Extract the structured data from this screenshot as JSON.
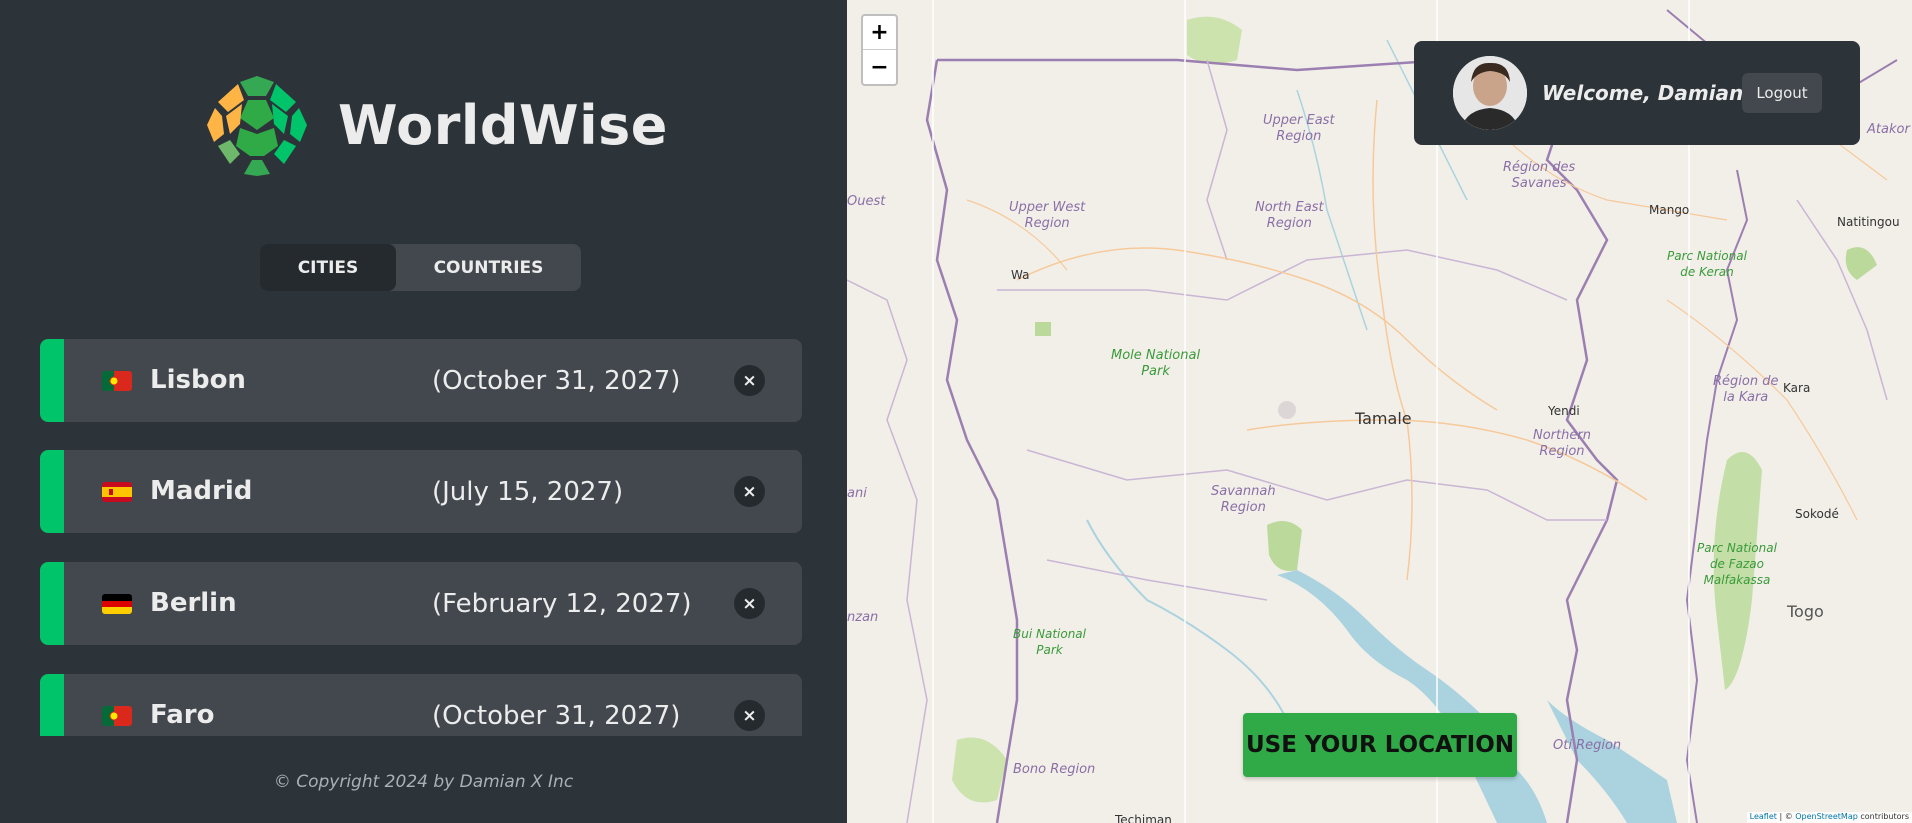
{
  "app": {
    "name": "WorldWise"
  },
  "tabs": [
    {
      "label": "CITIES",
      "active": true
    },
    {
      "label": "COUNTRIES",
      "active": false
    }
  ],
  "cities": [
    {
      "flag": "pt",
      "name": "Lisbon",
      "date": "(October 31, 2027)",
      "delete_label": "×"
    },
    {
      "flag": "es",
      "name": "Madrid",
      "date": "(July 15, 2027)",
      "delete_label": "×"
    },
    {
      "flag": "de",
      "name": "Berlin",
      "date": "(February 12, 2027)",
      "delete_label": "×"
    },
    {
      "flag": "pt",
      "name": "Faro",
      "date": "(October 31, 2027)",
      "delete_label": "×"
    }
  ],
  "footer": {
    "copyright": "© Copyright 2024 by Damian X Inc"
  },
  "map": {
    "zoom_in": "+",
    "zoom_out": "−",
    "labels": {
      "upper_east": "Upper East\nRegion",
      "upper_west": "Upper West\nRegion",
      "north_east": "North East\nRegion",
      "savanes": "Région des\nSavanes",
      "keran": "Parc National\nde Keran",
      "mole": "Mole National\nPark",
      "tamale": "Tamale",
      "yendi": "Yendi",
      "northern": "Northern\nRegion",
      "kara_region": "Région de\nla Kara",
      "kara": "Kara",
      "savannah": "Savannah\nRegion",
      "bui": "Bui National\nPark",
      "fazao": "Parc National\nde Fazao\nMalfakassa",
      "sokode": "Sokodé",
      "togo": "Togo",
      "oti": "Oti Region",
      "bono": "Bono Region",
      "wa": "Wa",
      "mango": "Mango",
      "natitingou": "Natitingou",
      "atakora": "Atakor",
      "ouest": "Ouest",
      "ani": "ani",
      "nzan": "nzan",
      "techiman": "Techiman"
    },
    "attribution_leaflet": "Leaflet",
    "attribution_sep": " | © ",
    "attribution_osm": "OpenStreetMap",
    "attribution_rest": " contributors"
  },
  "user": {
    "welcome": "Welcome, Damian",
    "logout_label": "Logout"
  },
  "locate_button": {
    "label": "USE YOUR LOCATION"
  },
  "colors": {
    "accent": "#00c46a",
    "panel_bg": "#2d3439",
    "item_bg": "#42484d",
    "locate_bg": "#2faa47"
  }
}
